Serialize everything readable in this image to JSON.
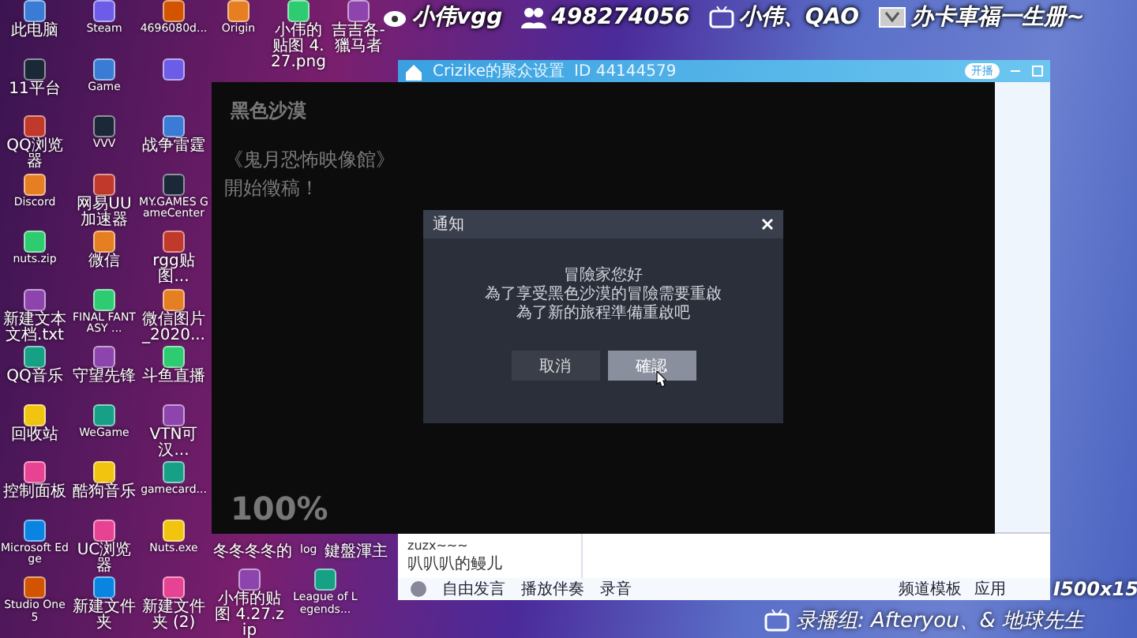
{
  "overlay_top": [
    {
      "kind": "weibo",
      "text": "小伟vgg"
    },
    {
      "kind": "group",
      "text": "498274056"
    },
    {
      "kind": "bilibili",
      "text": "小伟、QAO"
    },
    {
      "kind": "tv",
      "text": "办卡車福一生册~"
    }
  ],
  "desktop_columns": [
    [
      "此电脑",
      "11平台",
      "QQ浏览器",
      "Discord",
      "nuts.zip",
      "新建文本文档.txt",
      "QQ音乐",
      "回收站",
      "控制面板",
      "Microsoft Edge",
      "Studio One 5"
    ],
    [
      "Steam",
      "Game",
      "VVV",
      "网易UU加速器",
      "微信",
      "FINAL FANTASY ...",
      "守望先锋",
      "WeGame",
      "酷狗音乐",
      "UC浏览器",
      "新建文件夹"
    ],
    [
      "4696080d...",
      "",
      "战争雷霆",
      "MY.GAMES GameCenter",
      "rgg贴图...",
      "微信图片_2020...",
      "斗鱼直播",
      "VTN可汉...",
      "gamecard...",
      "Nuts.exe",
      "新建文件夹 (2)"
    ]
  ],
  "desktop_top_row": [
    "Origin",
    "小伟的贴图 4.27.png",
    "吉吉各-獵马者"
  ],
  "desktop_cut_labels": [
    "冬冬冬冬的",
    "log",
    "鍵盤渾主"
  ],
  "desktop_bottom_row": [
    "小伟的贴图 4.27.zip",
    "League of Legends..."
  ],
  "yy_window": {
    "title": "Crizike的聚众设置",
    "id": "ID 44144579",
    "toggle": "开播",
    "chat_lines": [
      "zuzx~~~",
      "叭叭叭的鳗儿"
    ],
    "toolbar": [
      "自由发言",
      "播放伴奏",
      "录音"
    ],
    "right_tools": [
      "频道模板",
      "应用"
    ]
  },
  "launcher": {
    "logo": "黑色沙漠",
    "headline": [
      "《鬼月恐怖映像館》",
      "開始徵稿！"
    ],
    "progress": "100%",
    "dialog": {
      "title": "通知",
      "lines": [
        "冒險家您好",
        "為了享受黑色沙漠的冒險需要重啟",
        "為了新的旅程準備重啟吧"
      ],
      "buttons": [
        {
          "label": "取消",
          "selected": false
        },
        {
          "label": "確認",
          "selected": true
        }
      ]
    }
  },
  "bottom_overlay": {
    "text": "录播组: Afteryou、& 地球先生",
    "badge": "I500x15"
  }
}
